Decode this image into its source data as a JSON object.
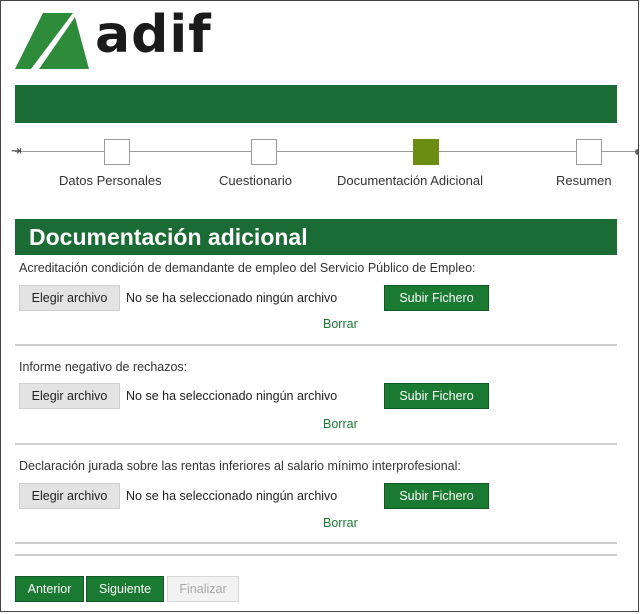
{
  "brand": {
    "name": "adif",
    "logo_color": "#2e8b3a",
    "bar_color": "#1a6b34"
  },
  "stepper": {
    "steps": [
      {
        "label": "Datos Personales",
        "active": false
      },
      {
        "label": "Cuestionario",
        "active": false
      },
      {
        "label": "Documentación Adicional",
        "active": true
      },
      {
        "label": "Resumen",
        "active": false
      }
    ],
    "start_glyph": "⇥"
  },
  "section": {
    "title": "Documentación adicional"
  },
  "documents": [
    {
      "label": "Acreditación condición de demandante de empleo del Servicio Público de Empleo:",
      "choose_label": "Elegir archivo",
      "file_status": "No se ha seleccionado ningún archivo",
      "upload_label": "Subir Fichero",
      "delete_label": "Borrar"
    },
    {
      "label": "Informe negativo de rechazos:",
      "choose_label": "Elegir archivo",
      "file_status": "No se ha seleccionado ningún archivo",
      "upload_label": "Subir Fichero",
      "delete_label": "Borrar"
    },
    {
      "label": "Declaración jurada sobre las rentas inferiores al salario mínimo interprofesional:",
      "choose_label": "Elegir archivo",
      "file_status": "No se ha seleccionado ningún archivo",
      "upload_label": "Subir Fichero",
      "delete_label": "Borrar"
    }
  ],
  "navigation": {
    "previous_label": "Anterior",
    "next_label": "Siguiente",
    "finish_label": "Finalizar"
  },
  "colors": {
    "primary_green": "#1a7a32",
    "active_step": "#6a8d12"
  }
}
